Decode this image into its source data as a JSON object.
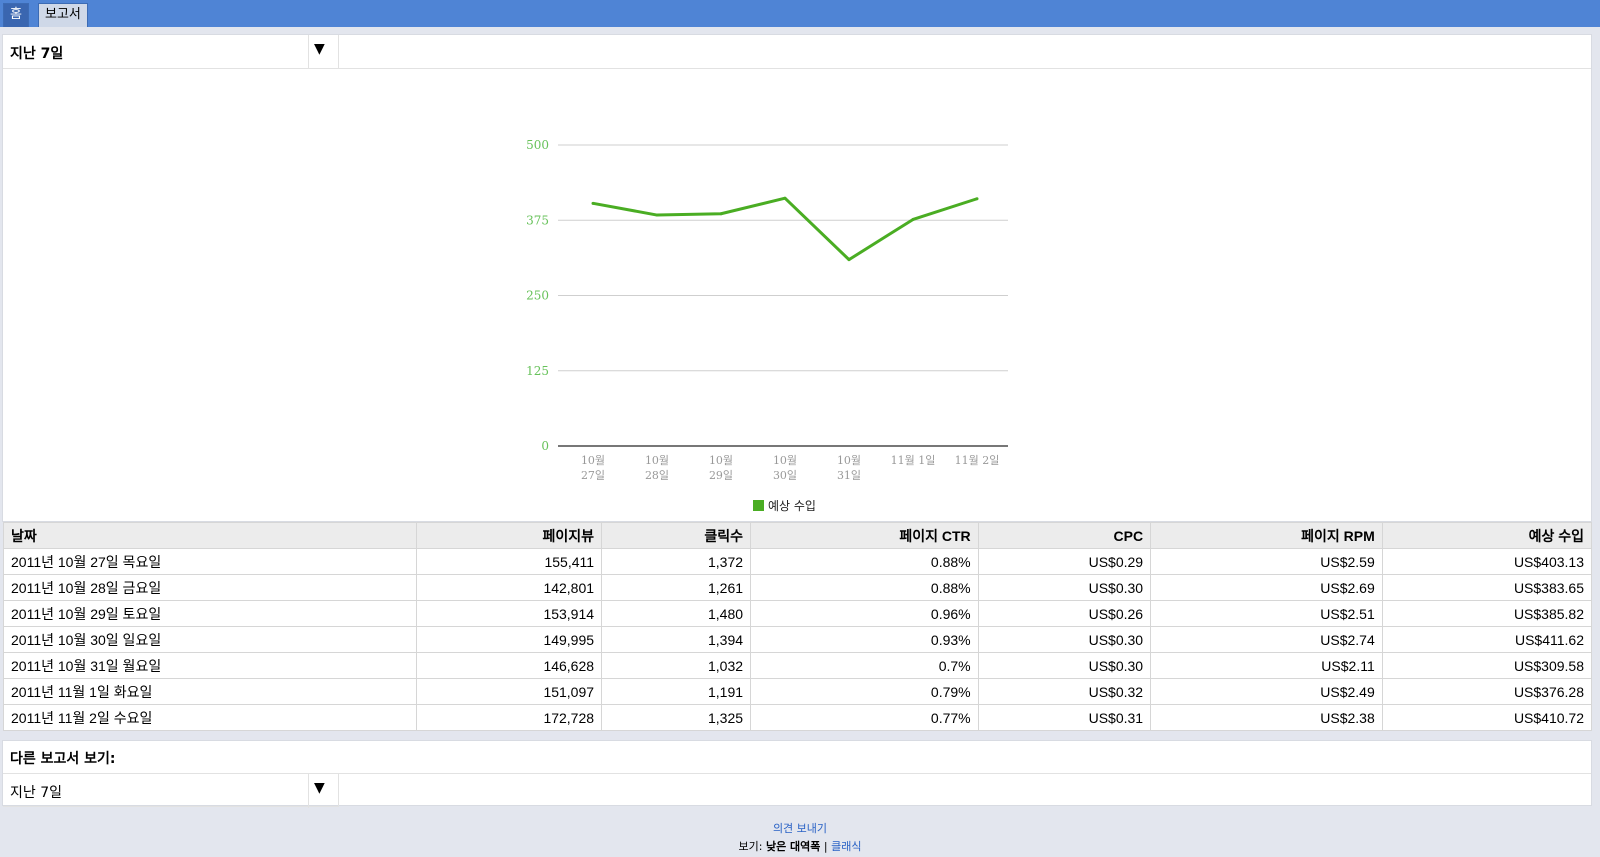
{
  "nav": {
    "home": "홈",
    "reports": "보고서"
  },
  "period_select": {
    "value": "지난 7일",
    "arrow": "▼"
  },
  "chart_data": {
    "type": "line",
    "categories": [
      [
        "10월",
        "27일"
      ],
      [
        "10월",
        "28일"
      ],
      [
        "10월",
        "29일"
      ],
      [
        "10월",
        "30일"
      ],
      [
        "10월",
        "31일"
      ],
      [
        "11월 1일"
      ],
      [
        "11월 2일"
      ]
    ],
    "series": [
      {
        "name": "예상 수입",
        "values": [
          403.13,
          383.65,
          385.82,
          411.62,
          309.58,
          376.28,
          410.72
        ],
        "color": "#4aad23"
      }
    ],
    "ylim": [
      0,
      500
    ],
    "yticks": [
      0,
      125,
      250,
      375,
      500
    ],
    "grid": true,
    "legend_position": "bottom-center",
    "axis_color": "#67c25a"
  },
  "table": {
    "headers": [
      "날짜",
      "페이지뷰",
      "클릭수",
      "페이지 CTR",
      "CPC",
      "페이지 RPM",
      "예상 수입"
    ],
    "rows": [
      [
        "2011년 10월 27일 목요일",
        "155,411",
        "1,372",
        "0.88%",
        "US$0.29",
        "US$2.59",
        "US$403.13"
      ],
      [
        "2011년 10월 28일 금요일",
        "142,801",
        "1,261",
        "0.88%",
        "US$0.30",
        "US$2.69",
        "US$383.65"
      ],
      [
        "2011년 10월 29일 토요일",
        "153,914",
        "1,480",
        "0.96%",
        "US$0.26",
        "US$2.51",
        "US$385.82"
      ],
      [
        "2011년 10월 30일 일요일",
        "149,995",
        "1,394",
        "0.93%",
        "US$0.30",
        "US$2.74",
        "US$411.62"
      ],
      [
        "2011년 10월 31일 월요일",
        "146,628",
        "1,032",
        "0.7%",
        "US$0.30",
        "US$2.11",
        "US$309.58"
      ],
      [
        "2011년 11월 1일 화요일",
        "151,097",
        "1,191",
        "0.79%",
        "US$0.32",
        "US$2.49",
        "US$376.28"
      ],
      [
        "2011년 11월 2일 수요일",
        "172,728",
        "1,325",
        "0.77%",
        "US$0.31",
        "US$2.38",
        "US$410.72"
      ]
    ]
  },
  "other_reports": {
    "title": "다른 보고서 보기:",
    "value": "지난 7일",
    "arrow": "▼"
  },
  "footer": {
    "feedback": "의견 보내기",
    "view_prefix": "보기:",
    "low_bandwidth": "낮은 대역폭",
    "separator": "|",
    "classic": "클래식"
  }
}
